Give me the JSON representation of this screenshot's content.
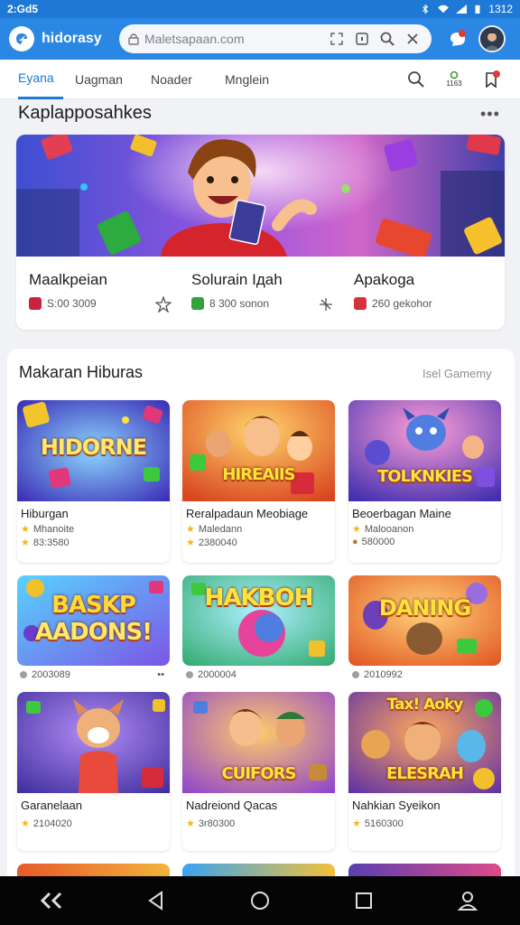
{
  "status_bar": {
    "time": "2:Gd5",
    "clock_right": "1312"
  },
  "app": {
    "name": "hidorasy"
  },
  "search": {
    "url": "Maletsapaan.com"
  },
  "tabs": [
    {
      "label": "Eyana",
      "active": true
    },
    {
      "label": "Uagman",
      "active": false
    },
    {
      "label": "Noader",
      "active": false
    },
    {
      "label": "Mnglein",
      "active": false
    }
  ],
  "tab_icon_labels": {
    "stats": "1163"
  },
  "section1": {
    "title": "Kaplapposahkes",
    "more": "•••",
    "items": [
      {
        "name": "Maalkpeian",
        "meta": "S:00 3009",
        "badge_color": "#c8243b",
        "action_icon": "star-outline-icon"
      },
      {
        "name": "Solurain Iдah",
        "meta": "8 300 sonon",
        "badge_color": "#33a23a",
        "action_icon": "share-icon"
      },
      {
        "name": "Apakoga",
        "meta": "260 gekohor",
        "badge_color": "#d6313f",
        "action_icon": ""
      }
    ]
  },
  "section2": {
    "title": "Makaran Hiburas",
    "link": "Isel Gamemy",
    "row1": [
      {
        "thumb_text": "HIDORNE",
        "title": "Hiburgan",
        "sub": "Mhanoite",
        "stat": "83:3580"
      },
      {
        "thumb_text": "HIREAIIS",
        "title": "Reralpadaun Meobiage",
        "sub": "Maledann",
        "stat": "2380040"
      },
      {
        "thumb_text": "TOLKNKIES",
        "title": "Beoerbagan Maine",
        "sub": "Malooanon",
        "stat": "580000"
      }
    ],
    "row2": [
      {
        "thumb_text_1": "BASKP",
        "thumb_text_2": "AADONS!",
        "stat": "2003089",
        "extra": "••"
      },
      {
        "thumb_text": "HAKBOH",
        "stat": "2000004"
      },
      {
        "thumb_text": "DANING",
        "stat": "2010992"
      }
    ],
    "row3": [
      {
        "thumb_text": "",
        "title": "Garanelaan",
        "stat": "2104020"
      },
      {
        "thumb_text": "CUIFORS",
        "title": "Nadreiond Qacas",
        "stat": "3r80300"
      },
      {
        "thumb_text_1": "Tax! Aoky",
        "thumb_text_2": "ELESRAH",
        "title": "Nahkian Syeikon",
        "stat": "5160300"
      }
    ]
  },
  "colors": {
    "primary": "#2a87e3",
    "accent": "#1e78d6",
    "star": "#f3b71b"
  }
}
